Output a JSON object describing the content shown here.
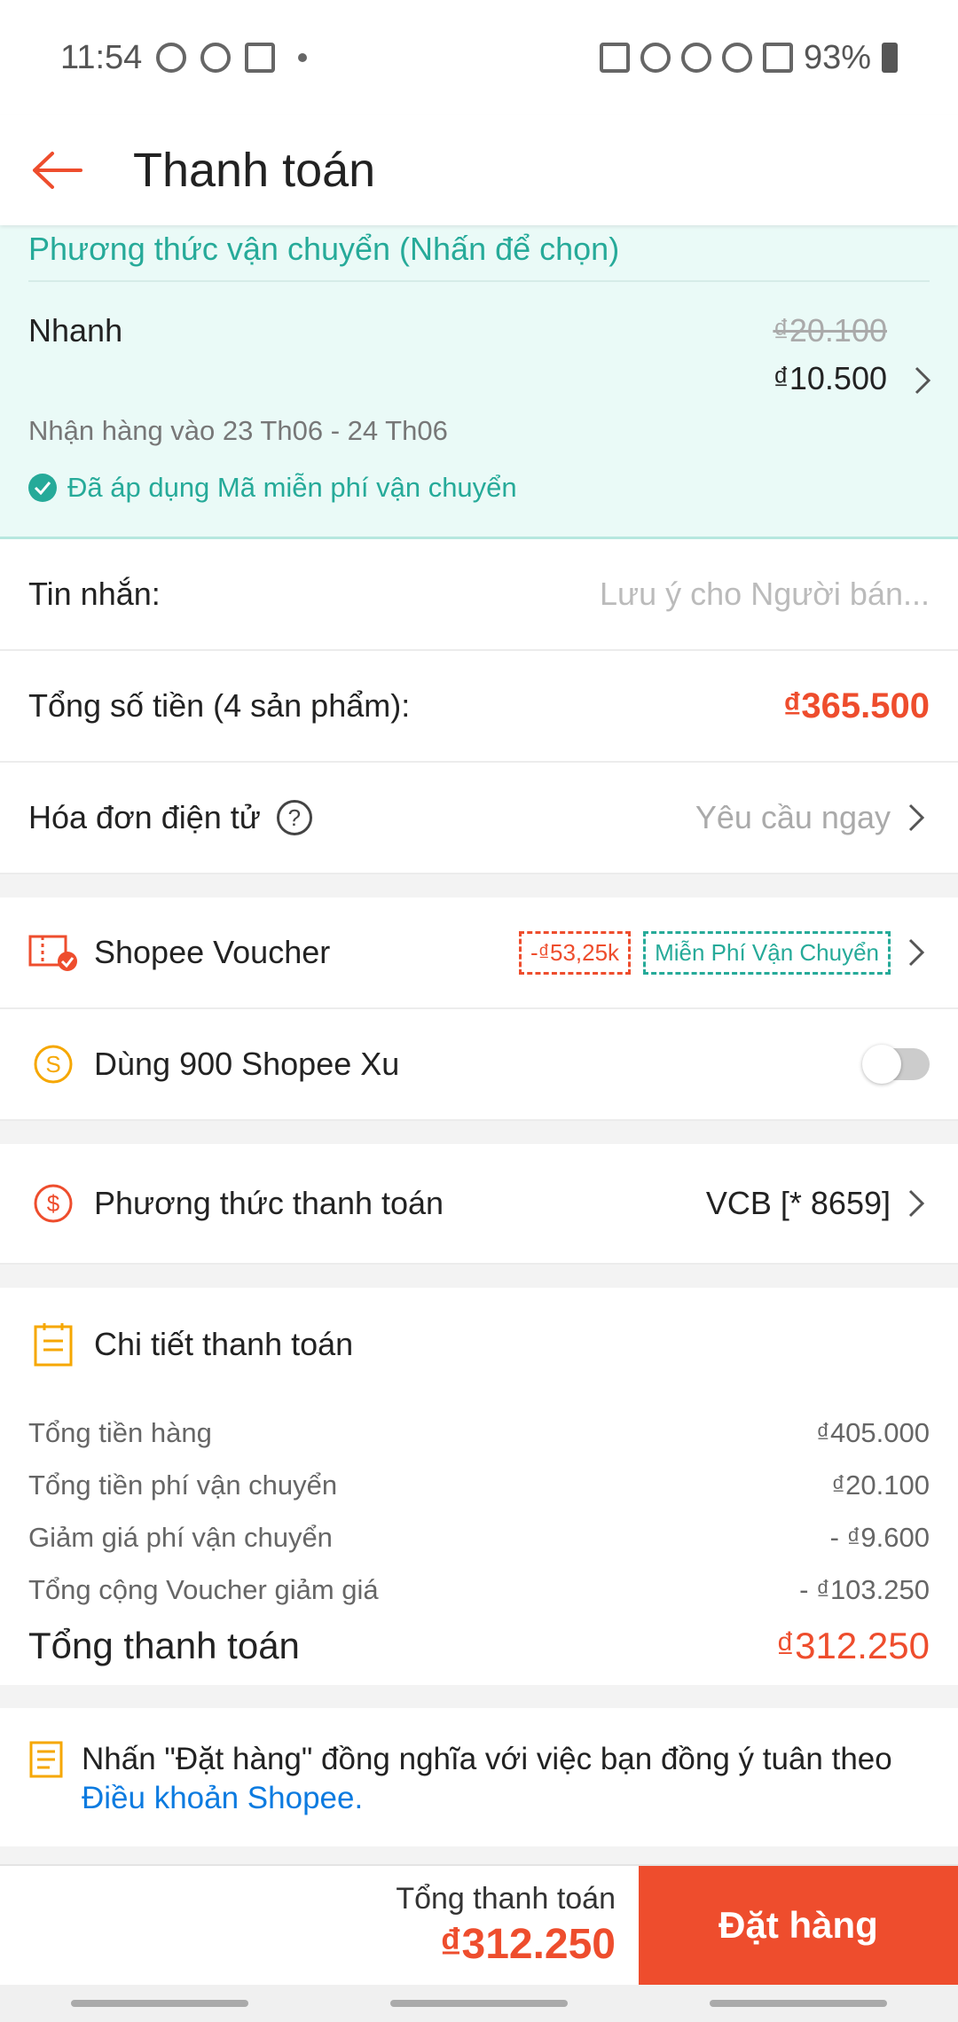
{
  "status_bar": {
    "time": "11:54",
    "battery": "93%"
  },
  "header": {
    "title": "Thanh toán"
  },
  "shipping": {
    "header": "Phương thức vận chuyển (Nhấn để chọn)",
    "name": "Nhanh",
    "old_price": "₫20.100",
    "new_price": "₫10.500",
    "delivery": "Nhận hàng vào 23 Th06 - 24 Th06",
    "applied": "Đã áp dụng Mã miễn phí vận chuyển"
  },
  "message": {
    "label": "Tin nhắn:",
    "placeholder": "Lưu ý cho Người bán..."
  },
  "subtotal": {
    "label": "Tổng số tiền (4 sản phẩm):",
    "value": "₫365.500"
  },
  "invoice": {
    "label": "Hóa đơn điện tử",
    "help": "?",
    "action": "Yêu cầu ngay"
  },
  "voucher": {
    "label": "Shopee Voucher",
    "discount_tag": "-₫53,25k",
    "shipping_tag": "Miễn Phí Vận Chuyển"
  },
  "coins": {
    "label": "Dùng 900 Shopee Xu",
    "enabled": false
  },
  "payment": {
    "label": "Phương thức thanh toán",
    "value": "VCB [* 8659]"
  },
  "details": {
    "title": "Chi tiết thanh toán",
    "lines": [
      {
        "label": "Tổng tiền hàng",
        "value": "₫405.000"
      },
      {
        "label": "Tổng tiền phí vận chuyển",
        "value": "₫20.100"
      },
      {
        "label": "Giảm giá phí vận chuyển",
        "value": "- ₫9.600"
      },
      {
        "label": "Tổng cộng Voucher giảm giá",
        "value": "- ₫103.250"
      }
    ],
    "total_label": "Tổng thanh toán",
    "total_value": "₫312.250"
  },
  "terms": {
    "text": "Nhấn \"Đặt hàng\" đồng nghĩa với việc bạn đồng ý tuân theo",
    "link": "Điều khoản Shopee."
  },
  "bottom": {
    "total_label": "Tổng thanh toán",
    "total_value": "₫312.250",
    "order_button": "Đặt hàng"
  },
  "colors": {
    "accent": "#ee4d2d",
    "teal": "#26aa99",
    "link": "#0c7be0",
    "coin": "#f6a700"
  }
}
